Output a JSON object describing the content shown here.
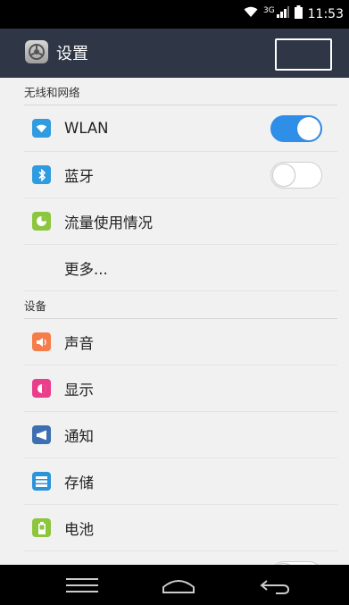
{
  "status_bar": {
    "network_type": "3G",
    "time": "11:53",
    "icons": [
      "wifi-icon",
      "cell-signal-icon",
      "battery-icon"
    ]
  },
  "title_bar": {
    "title": "设置",
    "app_icon": "settings-gear-icon"
  },
  "sections": [
    {
      "header": "无线和网络",
      "items": [
        {
          "label": "WLAN",
          "icon": "wifi-icon",
          "icon_color": "#2f9be0",
          "toggle": true
        },
        {
          "label": "蓝牙",
          "icon": "bluetooth-icon",
          "icon_color": "#2f9be0",
          "toggle": false
        },
        {
          "label": "流量使用情况",
          "icon": "data-usage-icon",
          "icon_color": "#8cc63e"
        },
        {
          "label": "更多..."
        }
      ]
    },
    {
      "header": "设备",
      "items": [
        {
          "label": "声音",
          "icon": "speaker-icon",
          "icon_color": "#f47d4a"
        },
        {
          "label": "显示",
          "icon": "brightness-icon",
          "icon_color": "#ea3e8a"
        },
        {
          "label": "通知",
          "icon": "megaphone-icon",
          "icon_color": "#3d6fb1"
        },
        {
          "label": "存储",
          "icon": "storage-icon",
          "icon_color": "#2b93d9"
        },
        {
          "label": "电池",
          "icon": "battery-icon",
          "icon_color": "#8cc63e"
        },
        {
          "label": "",
          "icon": "partial-icon",
          "icon_color": "#8cc63e",
          "toggle": false
        }
      ]
    }
  ],
  "nav_bar": {
    "buttons": [
      "recents-icon",
      "home-icon",
      "back-icon"
    ]
  },
  "colors": {
    "title_bar_bg": "#2f3646",
    "toggle_on": "#2f8ee8",
    "background": "#f1f1f1"
  }
}
